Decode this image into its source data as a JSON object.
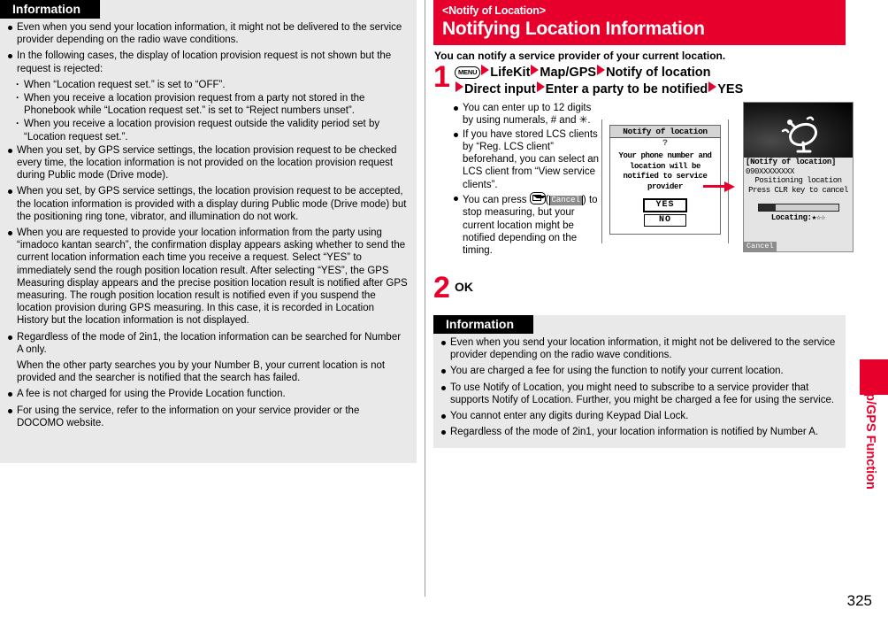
{
  "page": {
    "number": "325",
    "side_tab_label": "Map/GPS Function",
    "accent_color": "#e8002d",
    "infobox_bg": "#e9e9e9"
  },
  "left_column": {
    "info": {
      "header": "Information",
      "items": [
        {
          "type": "bullet",
          "text": "Even when you send your location information, it might not be delivered to the service provider depending on the radio wave conditions."
        },
        {
          "type": "bullet",
          "text": "In the following cases, the display of location provision request is not shown but the request is rejected:"
        },
        {
          "type": "sub",
          "text": "When “Location request set.” is set to “OFF”."
        },
        {
          "type": "sub",
          "text": "When you receive a location provision request from a party not stored in the Phonebook while “Location request set.” is set to “Reject numbers unset”."
        },
        {
          "type": "sub",
          "text": "When you receive a location provision request outside the validity period set by “Location request set.”."
        },
        {
          "type": "bullet",
          "text": "When you set, by GPS service settings, the location provision request to be checked every time, the location information is not provided on the location provision request during Public mode (Drive mode)."
        },
        {
          "type": "bullet",
          "text": "When you set, by GPS service settings, the location provision request to be accepted, the location information is provided with a display during Public mode (Drive mode) but the positioning ring tone, vibrator, and illumination do not work."
        },
        {
          "type": "bullet",
          "text": "When you are requested to provide your location information from the party using “imadoco kantan search”, the confirmation display appears asking whether to send the current location information each time you receive a request. Select “YES” to immediately send the rough position location result. After selecting “YES”, the GPS Measuring display appears and the precise position location result is notified after GPS measuring. The rough position location result is notified even if you suspend the location provision during GPS measuring. In this case, it is recorded in Location History but the location information is not displayed."
        },
        {
          "type": "bullet",
          "text": "Regardless of the mode of 2in1, the location information can be searched for Number A only."
        },
        {
          "type": "cont",
          "text": "When the other party searches you by your Number B, your current location is not provided and the searcher is notified that the search has failed."
        },
        {
          "type": "bullet",
          "text": "A fee is not charged for using the Provide Location function."
        },
        {
          "type": "bullet",
          "text": "For using the service, refer to the information on your service provider or the DOCOMO website."
        }
      ]
    }
  },
  "right_column": {
    "banner": {
      "kicker": "<Notify of Location>",
      "title": "Notifying Location Information"
    },
    "lead": "You can notify a service provider of your current location.",
    "step1": {
      "number": "1",
      "key_label": "MENU",
      "line1_parts": [
        "LifeKit",
        "Map/GPS",
        "Notify of location"
      ],
      "line2_parts": [
        "Direct input",
        "Enter a party to be notified",
        "YES"
      ],
      "notes": [
        {
          "text_before": "You can enter up to 12 digits by using numerals, # and ",
          "special": "✳",
          "text_after": "."
        },
        {
          "text_before": "If you have stored LCS clients by “Reg. LCS client” beforehand, you can select an LCS client from “View service clients”.",
          "special": "",
          "text_after": ""
        },
        {
          "text_before": "You can press ",
          "special": "mail-key",
          "text_after": " to stop measuring, but your current location might be notified depending on the timing.",
          "softkey_label": "Cancel"
        }
      ]
    },
    "phone_screen_1": {
      "title": "Notify of location",
      "icon": "?",
      "message": "Your phone number and location will be notified to service provider",
      "yes_label": "YES",
      "no_label": "NO"
    },
    "phone_screen_2": {
      "image_icon": "satellite-dish-icon",
      "caption": "[Notify of location]",
      "number": "090XXXXXXXX",
      "line1": "Positioning location",
      "line2": "Press CLR key to cancel",
      "progress_percent": 22,
      "locating_label": "Locating:",
      "stars": "★☆☆",
      "softkey_label": "Cancel"
    },
    "step2": {
      "number": "2",
      "label": "OK"
    },
    "info": {
      "header": "Information",
      "items": [
        {
          "type": "bullet",
          "text": "Even when you send your location information, it might not be delivered to the service provider depending on the radio wave conditions."
        },
        {
          "type": "bullet",
          "text": "You are charged a fee for using the function to notify your current location."
        },
        {
          "type": "bullet",
          "text": "To use Notify of Location, you might need to subscribe to a service provider that supports Notify of Location. Further, you might be charged a fee for using the service."
        },
        {
          "type": "bullet",
          "text": "You cannot enter any digits during Keypad Dial Lock."
        },
        {
          "type": "bullet",
          "text": "Regardless of the mode of 2in1, your location information is notified by Number A."
        }
      ]
    }
  }
}
